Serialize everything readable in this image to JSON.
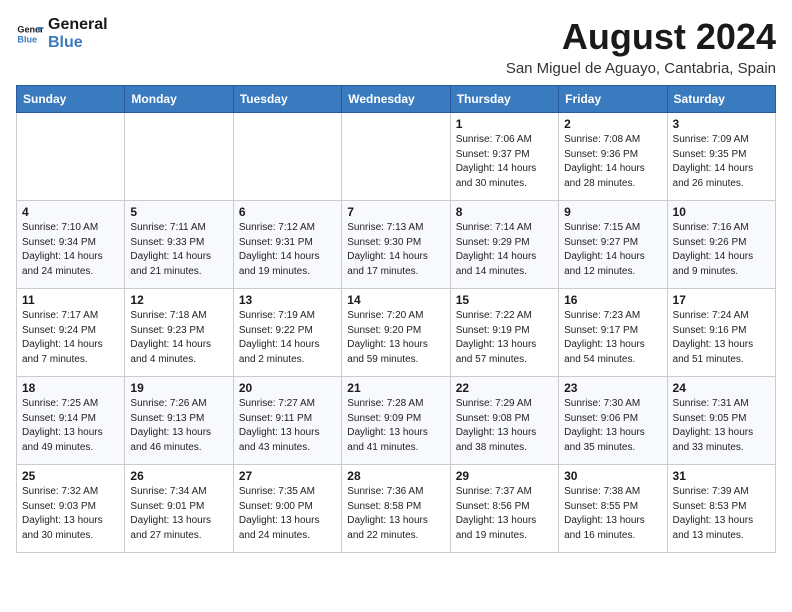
{
  "logo": {
    "line1": "General",
    "line2": "Blue"
  },
  "title": "August 2024",
  "location": "San Miguel de Aguayo, Cantabria, Spain",
  "days_of_week": [
    "Sunday",
    "Monday",
    "Tuesday",
    "Wednesday",
    "Thursday",
    "Friday",
    "Saturday"
  ],
  "weeks": [
    [
      {
        "day": "",
        "info": ""
      },
      {
        "day": "",
        "info": ""
      },
      {
        "day": "",
        "info": ""
      },
      {
        "day": "",
        "info": ""
      },
      {
        "day": "1",
        "info": "Sunrise: 7:06 AM\nSunset: 9:37 PM\nDaylight: 14 hours\nand 30 minutes."
      },
      {
        "day": "2",
        "info": "Sunrise: 7:08 AM\nSunset: 9:36 PM\nDaylight: 14 hours\nand 28 minutes."
      },
      {
        "day": "3",
        "info": "Sunrise: 7:09 AM\nSunset: 9:35 PM\nDaylight: 14 hours\nand 26 minutes."
      }
    ],
    [
      {
        "day": "4",
        "info": "Sunrise: 7:10 AM\nSunset: 9:34 PM\nDaylight: 14 hours\nand 24 minutes."
      },
      {
        "day": "5",
        "info": "Sunrise: 7:11 AM\nSunset: 9:33 PM\nDaylight: 14 hours\nand 21 minutes."
      },
      {
        "day": "6",
        "info": "Sunrise: 7:12 AM\nSunset: 9:31 PM\nDaylight: 14 hours\nand 19 minutes."
      },
      {
        "day": "7",
        "info": "Sunrise: 7:13 AM\nSunset: 9:30 PM\nDaylight: 14 hours\nand 17 minutes."
      },
      {
        "day": "8",
        "info": "Sunrise: 7:14 AM\nSunset: 9:29 PM\nDaylight: 14 hours\nand 14 minutes."
      },
      {
        "day": "9",
        "info": "Sunrise: 7:15 AM\nSunset: 9:27 PM\nDaylight: 14 hours\nand 12 minutes."
      },
      {
        "day": "10",
        "info": "Sunrise: 7:16 AM\nSunset: 9:26 PM\nDaylight: 14 hours\nand 9 minutes."
      }
    ],
    [
      {
        "day": "11",
        "info": "Sunrise: 7:17 AM\nSunset: 9:24 PM\nDaylight: 14 hours\nand 7 minutes."
      },
      {
        "day": "12",
        "info": "Sunrise: 7:18 AM\nSunset: 9:23 PM\nDaylight: 14 hours\nand 4 minutes."
      },
      {
        "day": "13",
        "info": "Sunrise: 7:19 AM\nSunset: 9:22 PM\nDaylight: 14 hours\nand 2 minutes."
      },
      {
        "day": "14",
        "info": "Sunrise: 7:20 AM\nSunset: 9:20 PM\nDaylight: 13 hours\nand 59 minutes."
      },
      {
        "day": "15",
        "info": "Sunrise: 7:22 AM\nSunset: 9:19 PM\nDaylight: 13 hours\nand 57 minutes."
      },
      {
        "day": "16",
        "info": "Sunrise: 7:23 AM\nSunset: 9:17 PM\nDaylight: 13 hours\nand 54 minutes."
      },
      {
        "day": "17",
        "info": "Sunrise: 7:24 AM\nSunset: 9:16 PM\nDaylight: 13 hours\nand 51 minutes."
      }
    ],
    [
      {
        "day": "18",
        "info": "Sunrise: 7:25 AM\nSunset: 9:14 PM\nDaylight: 13 hours\nand 49 minutes."
      },
      {
        "day": "19",
        "info": "Sunrise: 7:26 AM\nSunset: 9:13 PM\nDaylight: 13 hours\nand 46 minutes."
      },
      {
        "day": "20",
        "info": "Sunrise: 7:27 AM\nSunset: 9:11 PM\nDaylight: 13 hours\nand 43 minutes."
      },
      {
        "day": "21",
        "info": "Sunrise: 7:28 AM\nSunset: 9:09 PM\nDaylight: 13 hours\nand 41 minutes."
      },
      {
        "day": "22",
        "info": "Sunrise: 7:29 AM\nSunset: 9:08 PM\nDaylight: 13 hours\nand 38 minutes."
      },
      {
        "day": "23",
        "info": "Sunrise: 7:30 AM\nSunset: 9:06 PM\nDaylight: 13 hours\nand 35 minutes."
      },
      {
        "day": "24",
        "info": "Sunrise: 7:31 AM\nSunset: 9:05 PM\nDaylight: 13 hours\nand 33 minutes."
      }
    ],
    [
      {
        "day": "25",
        "info": "Sunrise: 7:32 AM\nSunset: 9:03 PM\nDaylight: 13 hours\nand 30 minutes."
      },
      {
        "day": "26",
        "info": "Sunrise: 7:34 AM\nSunset: 9:01 PM\nDaylight: 13 hours\nand 27 minutes."
      },
      {
        "day": "27",
        "info": "Sunrise: 7:35 AM\nSunset: 9:00 PM\nDaylight: 13 hours\nand 24 minutes."
      },
      {
        "day": "28",
        "info": "Sunrise: 7:36 AM\nSunset: 8:58 PM\nDaylight: 13 hours\nand 22 minutes."
      },
      {
        "day": "29",
        "info": "Sunrise: 7:37 AM\nSunset: 8:56 PM\nDaylight: 13 hours\nand 19 minutes."
      },
      {
        "day": "30",
        "info": "Sunrise: 7:38 AM\nSunset: 8:55 PM\nDaylight: 13 hours\nand 16 minutes."
      },
      {
        "day": "31",
        "info": "Sunrise: 7:39 AM\nSunset: 8:53 PM\nDaylight: 13 hours\nand 13 minutes."
      }
    ]
  ]
}
